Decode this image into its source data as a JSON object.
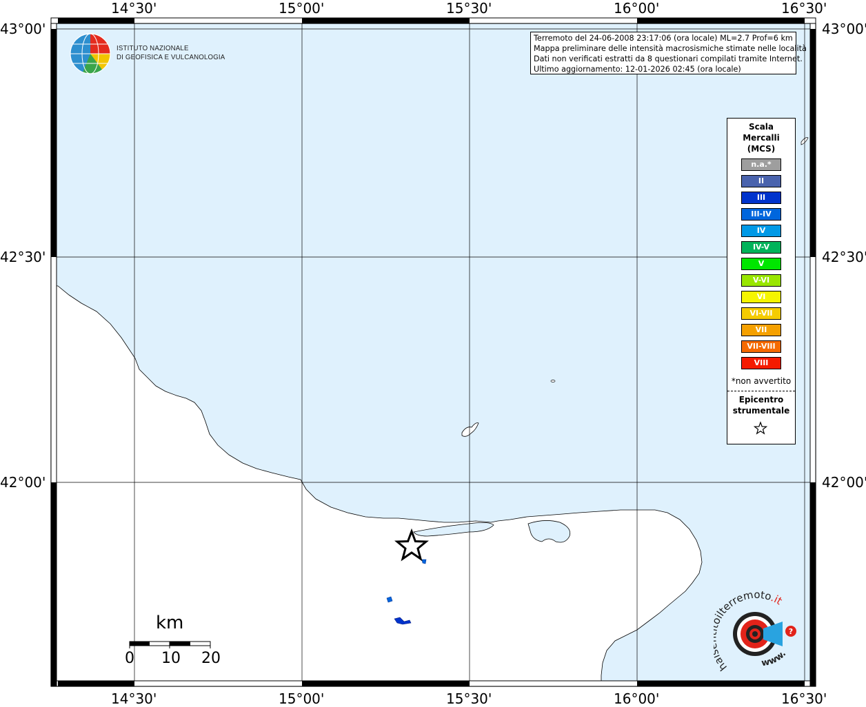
{
  "axes": {
    "top_labels": [
      "14°30'",
      "15°00'",
      "15°30'",
      "16°00'",
      "16°30'"
    ],
    "bottom_labels": [
      "14°30'",
      "15°00'",
      "15°30'",
      "16°00'",
      "16°30'"
    ],
    "left_labels": [
      "43°00'",
      "42°30'",
      "42°00'"
    ],
    "right_labels": [
      "43°00'",
      "42°30'",
      "42°00'"
    ]
  },
  "info": {
    "line1": "Terremoto del 24-06-2008 23:17:06 (ora locale) ML=2.7 Prof=6 km",
    "line2": "Mappa preliminare delle intensità macrosismiche stimate nelle località",
    "line3": "Dati non verificati estratti da 8 questionari compilati tramite Internet.",
    "line4": "Ultimo aggiornamento: 12-01-2026 02:45 (ora locale)"
  },
  "logo": {
    "line1": "ISTITUTO NAZIONALE",
    "line2": "DI GEOFISICA E VULCANOLOGIA"
  },
  "legend": {
    "title1": "Scala",
    "title2": "Mercalli",
    "title3": "(MCS)",
    "classes": [
      {
        "label": "n.a.*",
        "color": "#9e9e9e"
      },
      {
        "label": "II",
        "color": "#4a63ad"
      },
      {
        "label": "III",
        "color": "#0033cc"
      },
      {
        "label": "III-IV",
        "color": "#0066dd"
      },
      {
        "label": "IV",
        "color": "#0099e6"
      },
      {
        "label": "IV-V",
        "color": "#00b35a"
      },
      {
        "label": "V",
        "color": "#00e600"
      },
      {
        "label": "V-VI",
        "color": "#99e600"
      },
      {
        "label": "VI",
        "color": "#f5f500"
      },
      {
        "label": "VI-VII",
        "color": "#f5cc00"
      },
      {
        "label": "VII",
        "color": "#f5a000"
      },
      {
        "label": "VII-VIII",
        "color": "#f56a00"
      },
      {
        "label": "VIII",
        "color": "#f51a00"
      }
    ],
    "note": "*non avvertito",
    "epicentre1": "Epicentro",
    "epicentre2": "strumentale"
  },
  "scalebar": {
    "unit": "km",
    "labels": [
      "0",
      "10",
      "20"
    ]
  },
  "colors": {
    "sea": "#dff1fd",
    "land": "#ffffff",
    "grid": "#000000"
  },
  "intensity_points": [
    {
      "name": "dot-north",
      "mcs": "III-IV"
    },
    {
      "name": "dot-mid",
      "mcs": "III-IV"
    },
    {
      "name": "dot-south",
      "mcs": "III"
    }
  ],
  "badge": {
    "text_main": "haisentitoilterremoto",
    "text_accent": ".it",
    "text_www": "www."
  }
}
